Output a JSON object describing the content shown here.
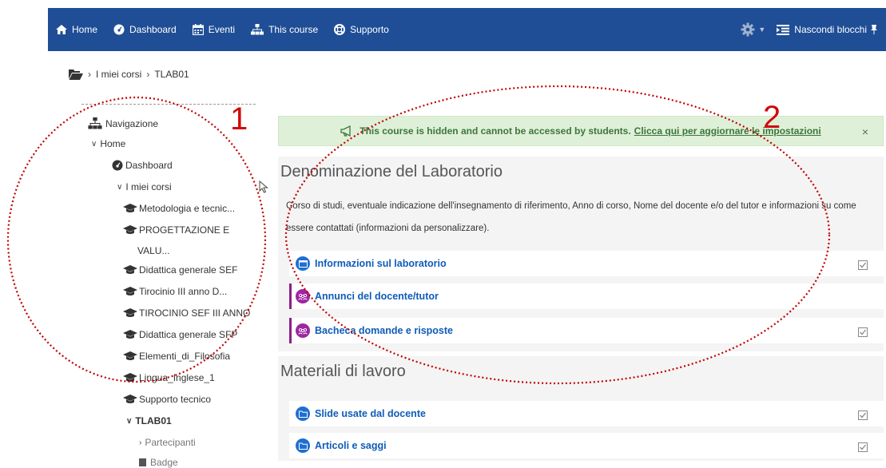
{
  "navbar": {
    "items": [
      {
        "label": "Home",
        "icon": "home-icon"
      },
      {
        "label": "Dashboard",
        "icon": "dashboard-icon"
      },
      {
        "label": "Eventi",
        "icon": "calendar-icon"
      },
      {
        "label": "This course",
        "icon": "sitemap-icon"
      },
      {
        "label": "Supporto",
        "icon": "lifebuoy-icon"
      }
    ],
    "settings_icon": "gear-icon",
    "hide_blocks_label": "Nascondi blocchi",
    "color": "#1f4e96"
  },
  "breadcrumb": {
    "items": [
      "I miei corsi",
      "TLAB01"
    ]
  },
  "nav_block": {
    "title": "Navigazione",
    "home": "Home",
    "dashboard": "Dashboard",
    "my_courses": "I miei corsi",
    "courses": [
      "Metodologia e tecnic...",
      "PROGETTAZIONE E",
      "VALU...",
      "Didattica generale SEF",
      "Tirocinio III anno D...",
      "TIROCINIO SEF III ANNO",
      "Didattica generale SFP",
      "Elementi_di_Filosofia",
      "Lingua_Inglese_1",
      "Supporto tecnico"
    ],
    "current_course": "TLAB01",
    "participants": "Partecipanti",
    "badges": "Badge"
  },
  "alert": {
    "text": "This course is hidden and cannot be accessed by students.",
    "link": "Clicca qui per aggiornare le impostazioni",
    "close": "×"
  },
  "sections": [
    {
      "title": "Denominazione del Laboratorio",
      "summary": "Corso di studi, eventuale indicazione dell'insegnamento di riferimento, Anno di corso, Nome del docente e/o del tutor e informazioni su come essere contattati (informazioni da personalizzare).",
      "activities": [
        {
          "name": "Informazioni sul laboratorio",
          "type": "page"
        },
        {
          "name": "Annunci del docente/tutor",
          "type": "forum"
        },
        {
          "name": "Bacheca domande e risposte",
          "type": "forum"
        }
      ]
    },
    {
      "title": "Materiali di lavoro",
      "activities": [
        {
          "name": "Slide usate dal docente",
          "type": "folder"
        },
        {
          "name": "Articoli e saggi",
          "type": "folder"
        }
      ]
    }
  ],
  "annotations": [
    "1",
    "2"
  ]
}
